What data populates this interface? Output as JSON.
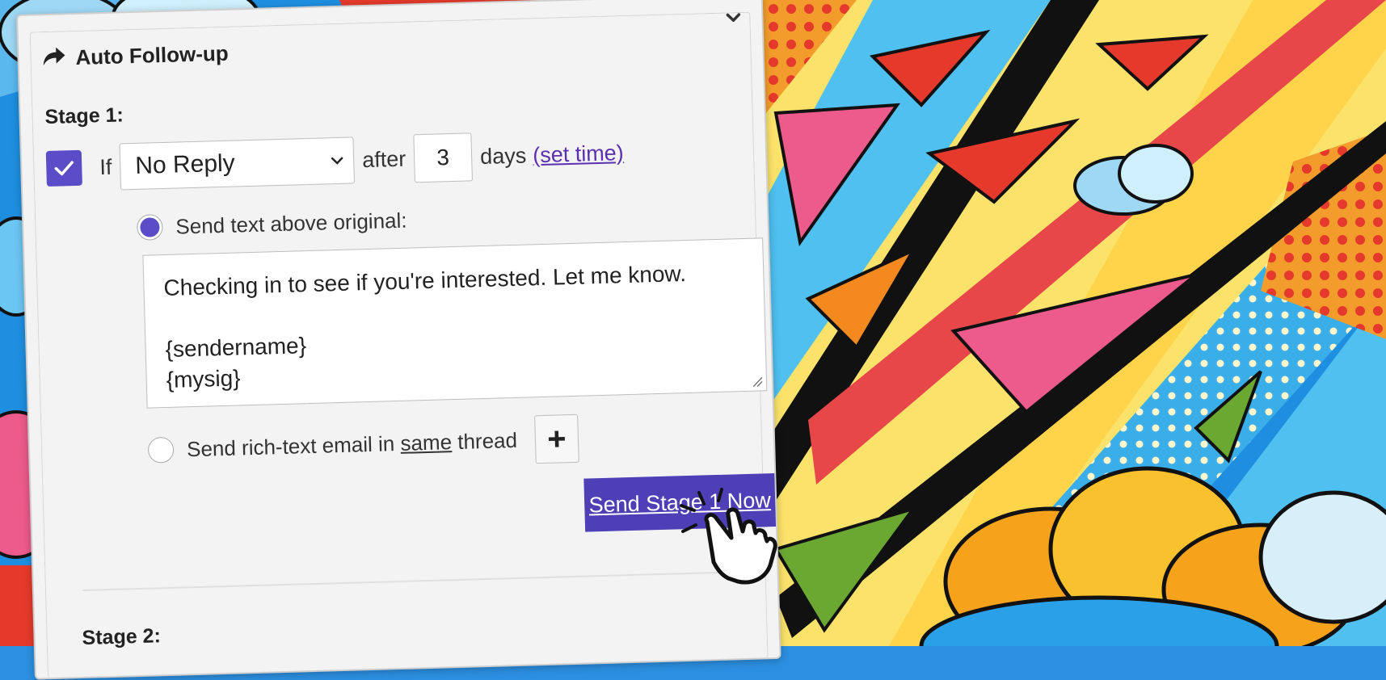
{
  "panel": {
    "title": "Auto Follow-up",
    "title_icon": "share-arrow-icon",
    "collapse_icon": "chevron-down-icon"
  },
  "stage1": {
    "label": "Stage 1:",
    "checked": true,
    "if_text": "If",
    "condition": "No Reply",
    "after_text": "after",
    "days_value": "3",
    "days_text": "days",
    "set_time_link": "(set time)",
    "option_text_label": "Send text above original:",
    "message_line1": "Checking in to see if you're interested. Let me know.",
    "message_line2": "{sendername}",
    "message_line3": "{mysig}",
    "option_rich_prefix": "Send rich-text email in ",
    "option_rich_emph": "same",
    "option_rich_suffix": " thread",
    "add_button_icon": "plus-icon",
    "send_now_button": "Send Stage 1 Now"
  },
  "stage2": {
    "label": "Stage 2:"
  },
  "colors": {
    "accent": "#4e3fb6",
    "link": "#5a2fb0"
  }
}
